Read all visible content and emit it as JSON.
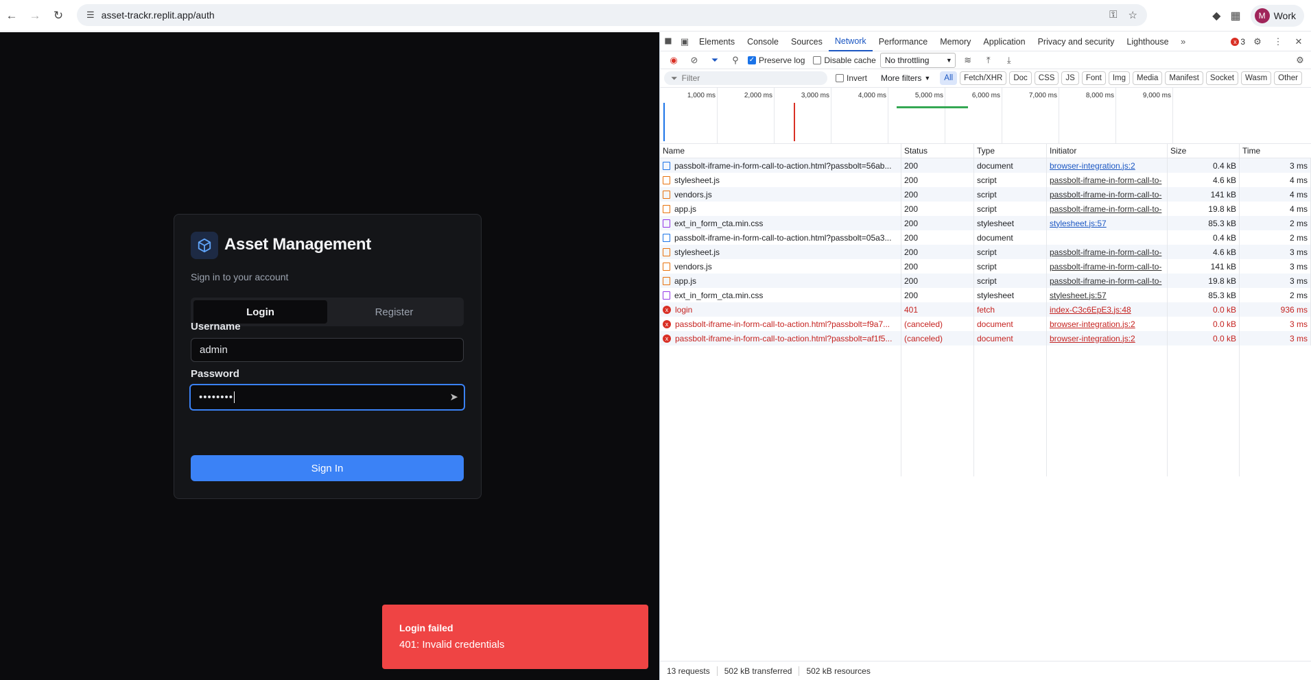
{
  "browser": {
    "url": "asset-trackr.replit.app/auth",
    "profile_initial": "M",
    "profile_name": "Work"
  },
  "app": {
    "title": "Asset Management",
    "subtitle": "Sign in to your account",
    "tabs": [
      {
        "label": "Login",
        "active": true
      },
      {
        "label": "Register",
        "active": false
      }
    ],
    "username_label": "Username",
    "username_value": "admin",
    "password_label": "Password",
    "password_value": "••••••••",
    "signin_label": "Sign In"
  },
  "toast": {
    "title": "Login failed",
    "message": "401: Invalid credentials"
  },
  "devtools": {
    "tabs": [
      "Elements",
      "Console",
      "Sources",
      "Network",
      "Performance",
      "Memory",
      "Application",
      "Privacy and security",
      "Lighthouse"
    ],
    "active_tab": "Network",
    "error_count": "3",
    "preserve_log": "Preserve log",
    "disable_cache": "Disable cache",
    "throttling": "No throttling",
    "filter_placeholder": "Filter",
    "invert": "Invert",
    "more_filters": "More filters",
    "type_filters": [
      "All",
      "Fetch/XHR",
      "Doc",
      "CSS",
      "JS",
      "Font",
      "Img",
      "Media",
      "Manifest",
      "Socket",
      "Wasm",
      "Other"
    ],
    "timeline_ticks": [
      "1,000 ms",
      "2,000 ms",
      "3,000 ms",
      "4,000 ms",
      "5,000 ms",
      "6,000 ms",
      "7,000 ms",
      "8,000 ms",
      "9,000 ms"
    ],
    "columns": [
      "Name",
      "Status",
      "Type",
      "Initiator",
      "Size",
      "Time"
    ],
    "rows": [
      {
        "icon": "doc",
        "name": "passbolt-iframe-in-form-call-to-action.html?passbolt=56ab...",
        "status": "200",
        "type": "document",
        "initiator": "browser-integration.js:2",
        "init_style": "blue",
        "size": "0.4 kB",
        "time": "3 ms",
        "error": false
      },
      {
        "icon": "js",
        "name": "stylesheet.js",
        "status": "200",
        "type": "script",
        "initiator": "passbolt-iframe-in-form-call-to-",
        "init_style": "plain",
        "size": "4.6 kB",
        "time": "4 ms",
        "error": false
      },
      {
        "icon": "js",
        "name": "vendors.js",
        "status": "200",
        "type": "script",
        "initiator": "passbolt-iframe-in-form-call-to-",
        "init_style": "plain",
        "size": "141 kB",
        "time": "4 ms",
        "error": false
      },
      {
        "icon": "js",
        "name": "app.js",
        "status": "200",
        "type": "script",
        "initiator": "passbolt-iframe-in-form-call-to-",
        "init_style": "plain",
        "size": "19.8 kB",
        "time": "4 ms",
        "error": false
      },
      {
        "icon": "css",
        "name": "ext_in_form_cta.min.css",
        "status": "200",
        "type": "stylesheet",
        "initiator": "stylesheet.js:57",
        "init_style": "blue",
        "size": "85.3 kB",
        "time": "2 ms",
        "error": false
      },
      {
        "icon": "doc",
        "name": "passbolt-iframe-in-form-call-to-action.html?passbolt=05a3...",
        "status": "200",
        "type": "document",
        "initiator": "",
        "init_style": "plain",
        "size": "0.4 kB",
        "time": "2 ms",
        "error": false
      },
      {
        "icon": "js",
        "name": "stylesheet.js",
        "status": "200",
        "type": "script",
        "initiator": "passbolt-iframe-in-form-call-to-",
        "init_style": "plain",
        "size": "4.6 kB",
        "time": "3 ms",
        "error": false
      },
      {
        "icon": "js",
        "name": "vendors.js",
        "status": "200",
        "type": "script",
        "initiator": "passbolt-iframe-in-form-call-to-",
        "init_style": "plain",
        "size": "141 kB",
        "time": "3 ms",
        "error": false
      },
      {
        "icon": "js",
        "name": "app.js",
        "status": "200",
        "type": "script",
        "initiator": "passbolt-iframe-in-form-call-to-",
        "init_style": "plain",
        "size": "19.8 kB",
        "time": "3 ms",
        "error": false
      },
      {
        "icon": "css",
        "name": "ext_in_form_cta.min.css",
        "status": "200",
        "type": "stylesheet",
        "initiator": "stylesheet.js:57",
        "init_style": "plain",
        "size": "85.3 kB",
        "time": "2 ms",
        "error": false
      },
      {
        "icon": "err",
        "name": "login",
        "status": "401",
        "type": "fetch",
        "initiator": "index-C3c6EpE3.js:48",
        "init_style": "plain",
        "size": "0.0 kB",
        "time": "936 ms",
        "error": true
      },
      {
        "icon": "err",
        "name": "passbolt-iframe-in-form-call-to-action.html?passbolt=f9a7...",
        "status": "(canceled)",
        "type": "document",
        "initiator": "browser-integration.js:2",
        "init_style": "plain",
        "size": "0.0 kB",
        "time": "3 ms",
        "error": true
      },
      {
        "icon": "err",
        "name": "passbolt-iframe-in-form-call-to-action.html?passbolt=af1f5...",
        "status": "(canceled)",
        "type": "document",
        "initiator": "browser-integration.js:2",
        "init_style": "plain",
        "size": "0.0 kB",
        "time": "3 ms",
        "error": true
      }
    ],
    "status_requests": "13 requests",
    "status_transferred": "502 kB transferred",
    "status_resources": "502 kB resources"
  }
}
